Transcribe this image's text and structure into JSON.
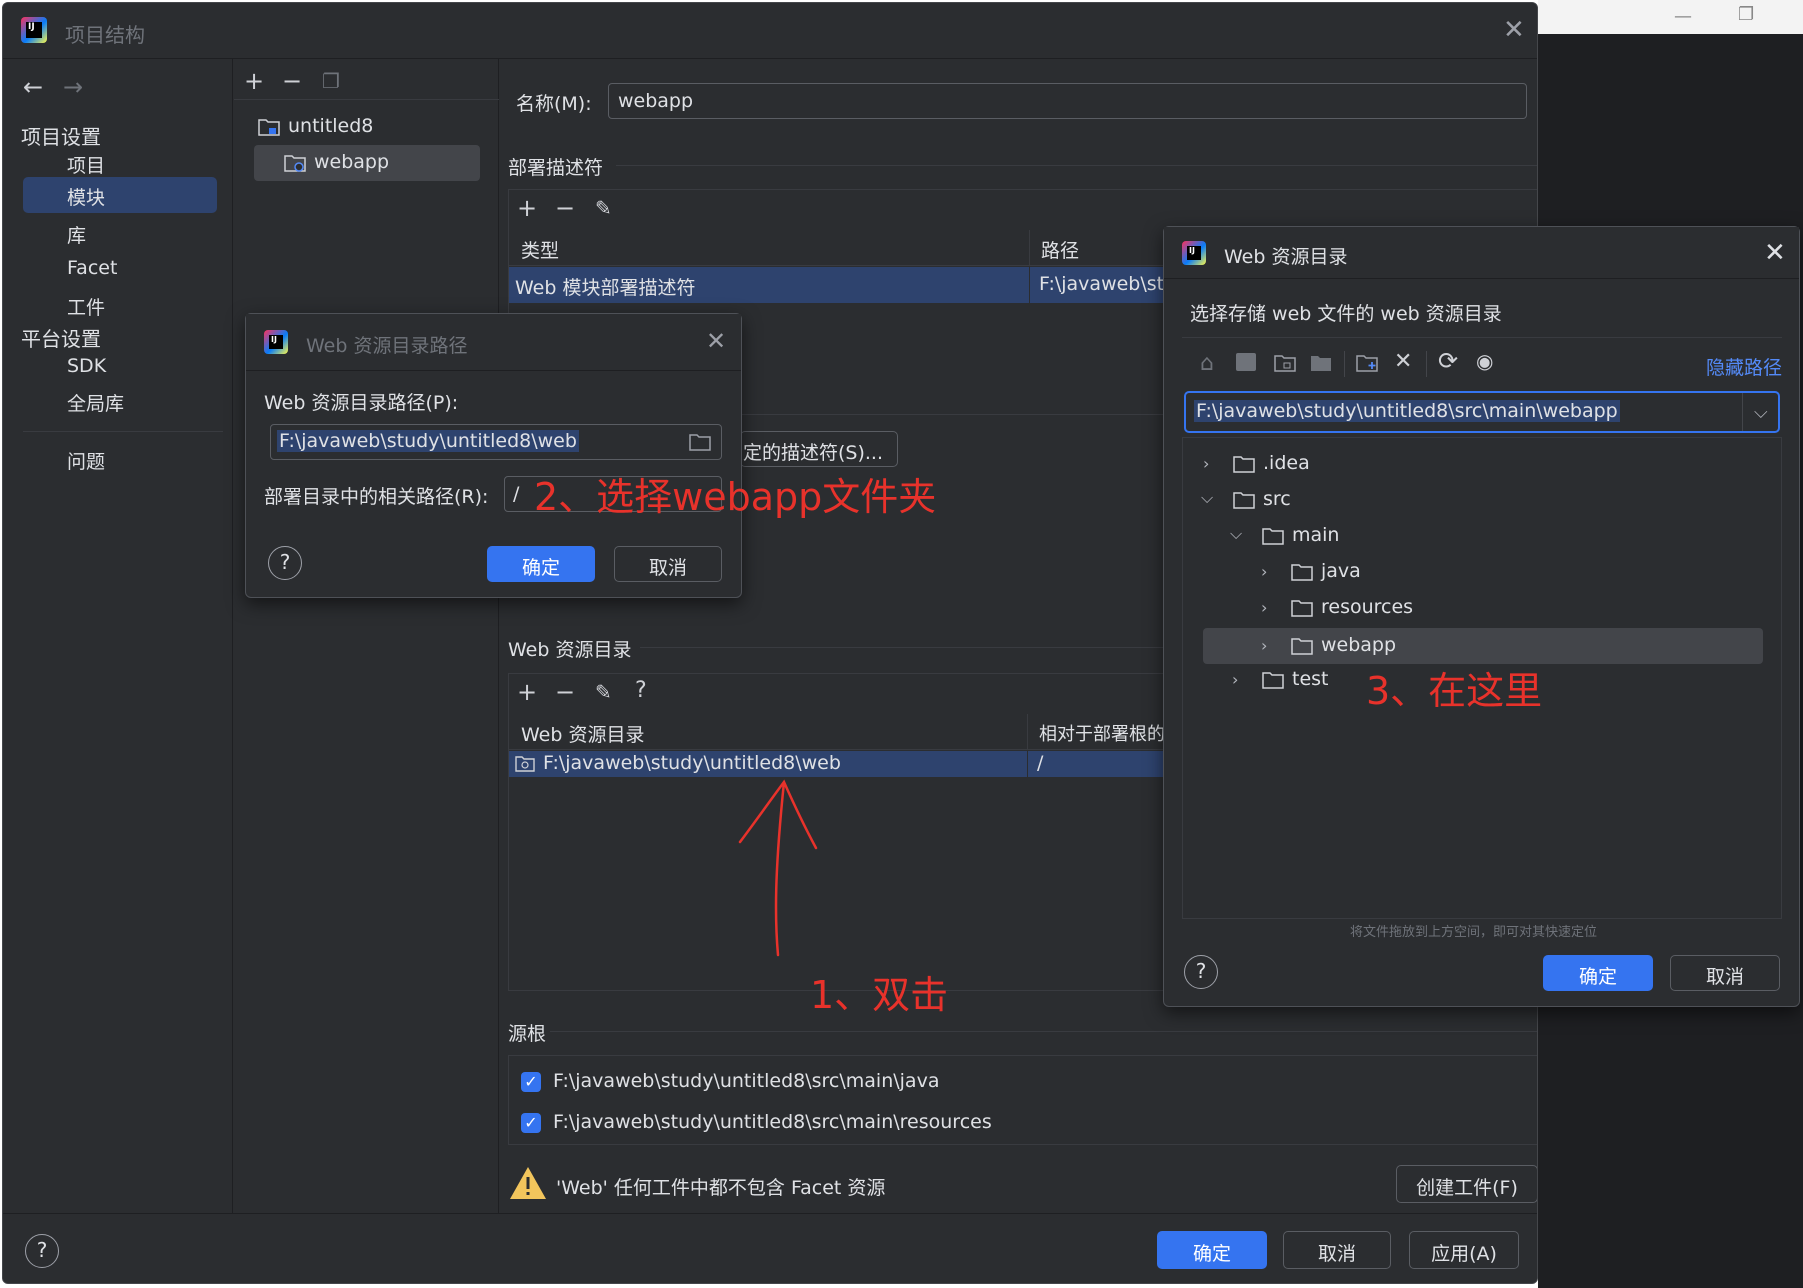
{
  "main_dialog": {
    "title": "项目结构",
    "sidebar": {
      "project_settings_label": "项目设置",
      "items": [
        "项目",
        "模块",
        "库",
        "Facet",
        "工件"
      ],
      "platform_settings_label": "平台设置",
      "platform_items": [
        "SDK",
        "全局库"
      ],
      "problems_label": "问题"
    },
    "module_tree": {
      "root": "untitled8",
      "child": "webapp"
    },
    "name_label": "名称(M):",
    "name_value": "webapp",
    "deploy_descriptors": {
      "section_title": "部署描述符",
      "col_type": "类型",
      "col_path": "路径",
      "row_type": "Web 模块部署描述符",
      "row_path": "F:\\javaweb\\stu",
      "server_descriptor_button": "定的描述符(S)..."
    },
    "web_resources": {
      "section_title": "Web 资源目录",
      "col_dir": "Web 资源目录",
      "col_relative": "相对于部署根的",
      "row_dir": "F:\\javaweb\\study\\untitled8\\web",
      "row_relative": "/"
    },
    "source_roots": {
      "section_title": "源根",
      "items": [
        "F:\\javaweb\\study\\untitled8\\src\\main\\java",
        "F:\\javaweb\\study\\untitled8\\src\\main\\resources"
      ]
    },
    "warning_text": "'Web' 任何工件中都不包含 Facet 资源",
    "create_artifact_button": "创建工件(F)",
    "footer": {
      "ok": "确定",
      "cancel": "取消",
      "apply": "应用(A)"
    }
  },
  "path_dialog": {
    "title": "Web 资源目录路径",
    "path_label": "Web 资源目录路径(P):",
    "path_value": "F:\\javaweb\\study\\untitled8\\web",
    "relative_label": "部署目录中的相关路径(R):",
    "relative_value": "/",
    "ok": "确定",
    "cancel": "取消"
  },
  "resource_dialog": {
    "title": "Web 资源目录",
    "subtitle": "选择存储 web 文件的 web 资源目录",
    "hide_path_link": "隐藏路径",
    "path_value": "F:\\javaweb\\study\\untitled8\\src\\main\\webapp",
    "tree": [
      {
        "label": ".idea",
        "level": 0,
        "expanded": false
      },
      {
        "label": "src",
        "level": 0,
        "expanded": true
      },
      {
        "label": "main",
        "level": 1,
        "expanded": true
      },
      {
        "label": "java",
        "level": 2,
        "expanded": false
      },
      {
        "label": "resources",
        "level": 2,
        "expanded": false
      },
      {
        "label": "webapp",
        "level": 2,
        "expanded": false,
        "selected": true
      },
      {
        "label": "test",
        "level": 1,
        "expanded": false
      }
    ],
    "drop_hint": "将文件拖放到上方空间，即可对其快速定位",
    "ok": "确定",
    "cancel": "取消"
  },
  "annotations": {
    "step1": "1、双击",
    "step2": "2、选择webapp文件夹",
    "step3": "3、在这里"
  },
  "colors": {
    "accent": "#3574f0",
    "selection": "#2e436e",
    "annotation_red": "#e8322b",
    "background": "#2b2d30"
  }
}
